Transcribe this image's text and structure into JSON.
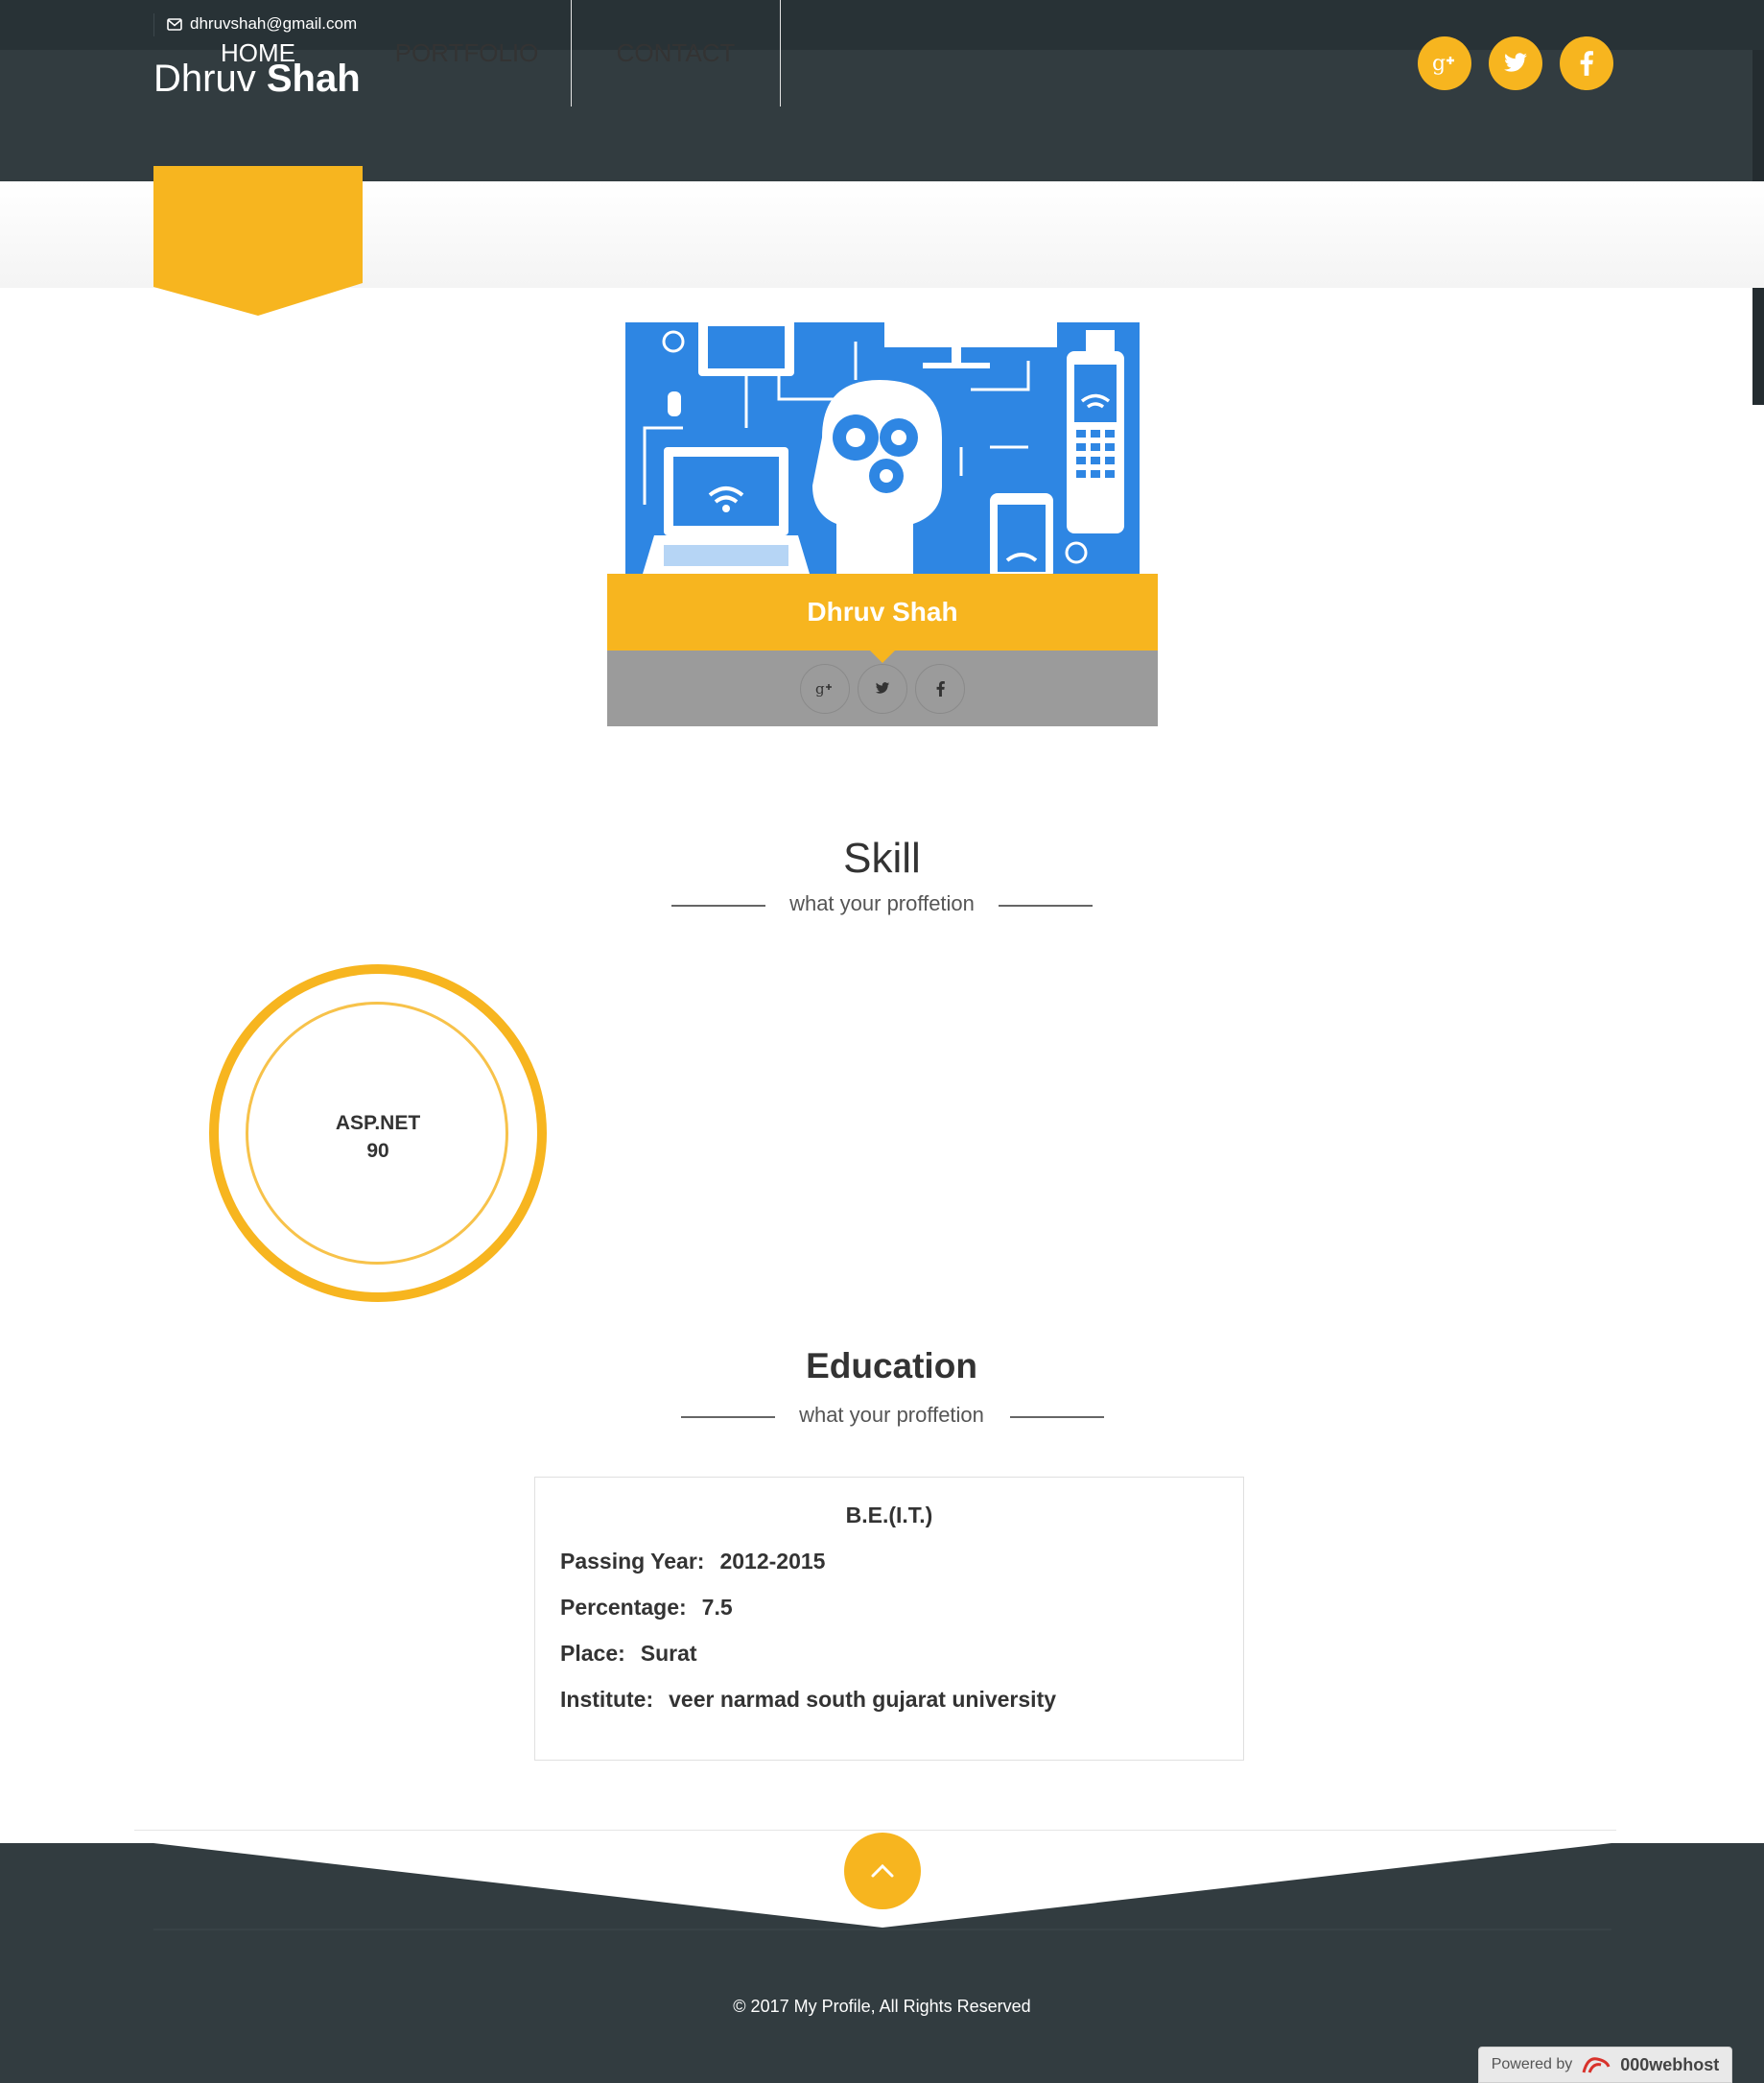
{
  "topbar": {
    "email": "dhruvshah@gmail.com",
    "email_icon": "envelope-icon"
  },
  "header": {
    "brand_first": "Dhruv",
    "brand_last": "Shah",
    "social": [
      "google-plus-icon",
      "twitter-icon",
      "facebook-icon"
    ]
  },
  "nav": {
    "items": [
      {
        "label": "HOME",
        "active": true
      },
      {
        "label": "PORTFOLIO",
        "active": false
      },
      {
        "label": "CONTACT",
        "active": false
      }
    ]
  },
  "profile": {
    "name": "Dhruv Shah",
    "social": [
      "google-plus-icon",
      "twitter-icon",
      "facebook-icon"
    ]
  },
  "skill": {
    "title": "Skill",
    "subtitle": "what your proffetion",
    "items": [
      {
        "name": "ASP.NET",
        "value": "90"
      }
    ]
  },
  "education": {
    "title": "Education",
    "subtitle": "what your proffetion",
    "degree": "B.E.(I.T.)",
    "rows": [
      {
        "label": "Passing Year:",
        "value": "2012-2015"
      },
      {
        "label": "Percentage:",
        "value": "7.5"
      },
      {
        "label": "Place:",
        "value": "Surat"
      },
      {
        "label": "Institute:",
        "value": "veer narmad south gujarat university"
      }
    ]
  },
  "footer": {
    "copyright": "© 2017 My Profile, All Rights Reserved",
    "powered_by": "Powered by",
    "host": "000webhost"
  },
  "colors": {
    "accent": "#f7b51f",
    "dark": "#323c40",
    "darker": "#283236",
    "social_bar": "#9b9b9b",
    "illustration_blue": "#2e86e3"
  }
}
